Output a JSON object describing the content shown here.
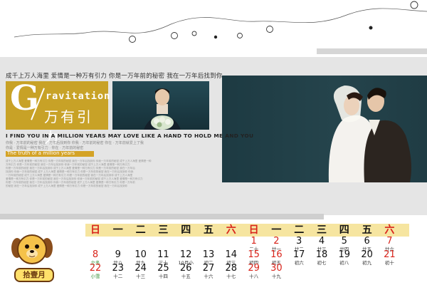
{
  "tagline": "成千上万人海里 爱情是一种万有引力 你是一万年前的秘密 我在一万年后找到你",
  "logo_letter": "G",
  "title_word": "ravitation",
  "title_cn": "万有引力",
  "english_line": "I FIND YOU IN A MILLION YEARS MAY LOVE LIKE A HAND TO HOLD ME AND YOU",
  "small_cn": [
    "你我 · 万年前的秘密 我在 · 万年后找到你 你我 · 万年前的秘密 你在 · 万年前就爱上了我",
    "你是 · 爱情是一种万有引力 · 你在 · 万年前的秘密"
  ],
  "truth_label": "The truth of a million years",
  "paragraph_lines": [
    "成千上万人海里 爱情是一种万有引力 你是一万年前的秘密 我在一万年后找到你 你我一万年前的秘密 成千上万人海里 爱情是一种",
    "万有引力 你是一万年前的秘密 我在一万年后找到你 你我一万年前的秘密 成千上万人海里 爱情是一种万有引力",
    "你是一万年前的秘密 我在一万年后找到你 成千上万人海里 爱情是一种万有引力 你是一万年前的秘密 我在一万年后",
    "找到你 你我一万年前的秘密 成千上万人海里 爱情是一种万有引力 你是一万年前的秘密 我在一万年后找到你 你我",
    "一万年前的秘密 成千上万人海里 爱情是一种万有引力 你是一万年前的秘密 我在一万年后找到你 成千上万人海里",
    "爱情是一种万有引力 你是一万年前的秘密 我在一万年后找到你 你我一万年前的秘密 成千上万人海里 爱情是一种万有引力",
    "你是一万年前的秘密 我在一万年后找到你 你我一万年前的秘密 成千上万人海里 爱情是一种万有引力 你是一万年前",
    "的秘密 我在一万年后找到你 成千上万人海里 爱情是一种万有引力 你是一万年前的秘密 我在一万年后找到你"
  ],
  "logo_text": "拾壹月",
  "weekdays": [
    "日",
    "一",
    "二",
    "三",
    "四",
    "五",
    "六",
    "日",
    "一",
    "二",
    "三",
    "四",
    "五",
    "六"
  ],
  "colors": {
    "gold": "#c8a227",
    "header_band": "#f6e5a0",
    "red": "#d9241b",
    "green": "#2e8b2e"
  },
  "calendar": [
    {
      "col": 7,
      "row": 0,
      "num": "1",
      "lunar": "二十",
      "num_color": "#d9241b"
    },
    {
      "col": 8,
      "row": 0,
      "num": "2",
      "lunar": "廿一",
      "num_color": "#d9241b"
    },
    {
      "col": 9,
      "row": 0,
      "num": "3",
      "lunar": "廿二"
    },
    {
      "col": 10,
      "row": 0,
      "num": "4",
      "lunar": "廿三"
    },
    {
      "col": 11,
      "row": 0,
      "num": "5",
      "lunar": "廿四"
    },
    {
      "col": 12,
      "row": 0,
      "num": "6",
      "lunar": "廿五"
    },
    {
      "col": 13,
      "row": 0,
      "num": "7",
      "lunar": "廿六",
      "num_color": "#d9241b"
    },
    {
      "col": 0,
      "row": 1,
      "num": "8",
      "lunar": "立冬",
      "num_color": "#d9241b",
      "lunar_color": "#2e8b2e"
    },
    {
      "col": 1,
      "row": 1,
      "num": "9",
      "lunar": "廿八"
    },
    {
      "col": 2,
      "row": 1,
      "num": "10",
      "lunar": "廿九"
    },
    {
      "col": 3,
      "row": 1,
      "num": "11",
      "lunar": "三十"
    },
    {
      "col": 4,
      "row": 1,
      "num": "12",
      "lunar": "10月小"
    },
    {
      "col": 5,
      "row": 1,
      "num": "13",
      "lunar": "初二"
    },
    {
      "col": 6,
      "row": 1,
      "num": "14",
      "lunar": "初三"
    },
    {
      "col": 7,
      "row": 1,
      "num": "15",
      "lunar": "初四",
      "num_color": "#d9241b"
    },
    {
      "col": 8,
      "row": 1,
      "num": "16",
      "lunar": "初五",
      "num_color": "#d9241b"
    },
    {
      "col": 9,
      "row": 1,
      "num": "17",
      "lunar": "初六"
    },
    {
      "col": 10,
      "row": 1,
      "num": "18",
      "lunar": "初七"
    },
    {
      "col": 11,
      "row": 1,
      "num": "19",
      "lunar": "初八"
    },
    {
      "col": 12,
      "row": 1,
      "num": "20",
      "lunar": "初九"
    },
    {
      "col": 13,
      "row": 1,
      "num": "21",
      "lunar": "初十",
      "num_color": "#d9241b"
    },
    {
      "col": 0,
      "row": 2,
      "num": "22",
      "lunar": "小雪",
      "num_color": "#d9241b",
      "lunar_color": "#2e8b2e"
    },
    {
      "col": 1,
      "row": 2,
      "num": "23",
      "lunar": "十二"
    },
    {
      "col": 2,
      "row": 2,
      "num": "24",
      "lunar": "十三"
    },
    {
      "col": 3,
      "row": 2,
      "num": "25",
      "lunar": "十四"
    },
    {
      "col": 4,
      "row": 2,
      "num": "26",
      "lunar": "十五"
    },
    {
      "col": 5,
      "row": 2,
      "num": "27",
      "lunar": "十六"
    },
    {
      "col": 6,
      "row": 2,
      "num": "28",
      "lunar": "十七"
    },
    {
      "col": 7,
      "row": 2,
      "num": "29",
      "lunar": "十八",
      "num_color": "#d9241b"
    },
    {
      "col": 8,
      "row": 2,
      "num": "30",
      "lunar": "十九",
      "num_color": "#d9241b"
    }
  ]
}
